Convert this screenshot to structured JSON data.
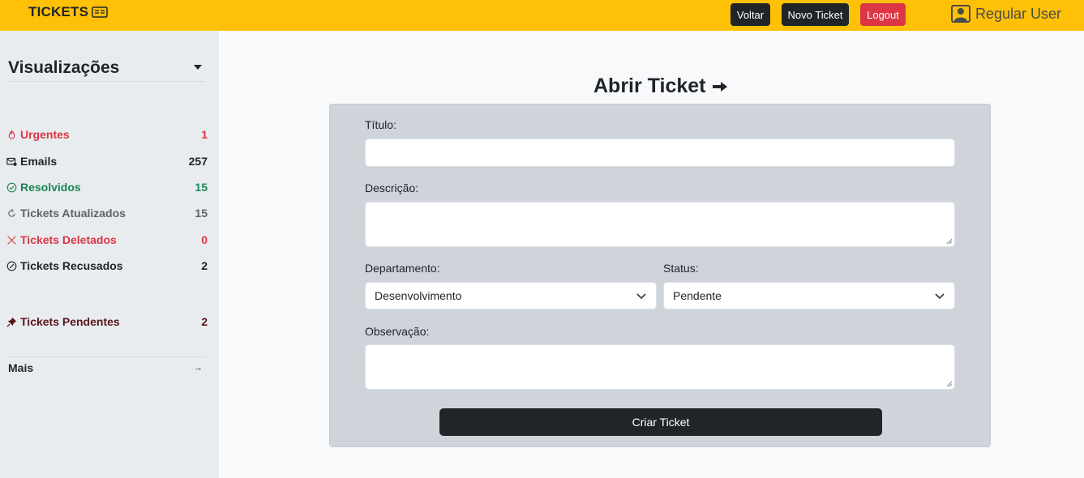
{
  "header": {
    "brand": "TICKETS",
    "buttons": {
      "back": "Voltar",
      "new_ticket": "Novo Ticket",
      "logout": "Logout"
    },
    "user": "Regular User"
  },
  "sidebar": {
    "title": "Visualizações",
    "items": [
      {
        "label": "Urgentes",
        "count": "1",
        "icon": "fire-icon",
        "color": "#dc3545"
      },
      {
        "label": "Emails",
        "count": "257",
        "icon": "envelope-icon",
        "color": "#212529"
      },
      {
        "label": "Resolvidos",
        "count": "15",
        "icon": "check-circle-icon",
        "color": "#198754"
      },
      {
        "label": "Tickets Atualizados",
        "count": "15",
        "icon": "refresh-icon",
        "color": "#5c636a"
      },
      {
        "label": "Tickets Deletados",
        "count": "0",
        "icon": "x-icon",
        "color": "#dc3545"
      },
      {
        "label": "Tickets Recusados",
        "count": "2",
        "icon": "slash-circle-icon",
        "color": "#212529"
      },
      {
        "label": "Tickets Pendentes",
        "count": "2",
        "icon": "pin-icon",
        "color": "#58151c"
      }
    ],
    "more": "Mais"
  },
  "form": {
    "heading": "Abrir Ticket",
    "title_label": "Título:",
    "title_value": "",
    "description_label": "Descrição:",
    "description_value": "",
    "department_label": "Departamento:",
    "department_value": "Desenvolvimento",
    "status_label": "Status:",
    "status_value": "Pendente",
    "observation_label": "Observação:",
    "observation_value": "",
    "submit": "Criar Ticket"
  },
  "colors": {
    "accent": "#ffc107",
    "dark": "#212529",
    "danger": "#dc3545",
    "success": "#198754"
  }
}
